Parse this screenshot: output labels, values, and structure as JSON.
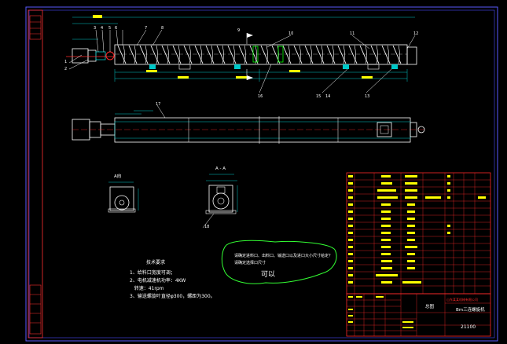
{
  "drawing": {
    "callouts": [
      "1",
      "2",
      "3",
      "4",
      "5",
      "6",
      "7",
      "8",
      "9",
      "10",
      "11",
      "12",
      "13",
      "14",
      "15",
      "16",
      "17",
      "18"
    ],
    "section_label": "A - A",
    "view_label": "A向",
    "section_marks": [
      "A",
      "A"
    ],
    "tech_requirements": {
      "title": "技术要求",
      "items": [
        "1、给料口宽度可调；",
        "2、电机减速机功率：4KW",
        "   转速：41rpm",
        "3、输送螺旋叶直径φ300，螺距为300。"
      ]
    },
    "annotation": {
      "lines": [
        "请确定进料口、出料口、输送口以及进口大小尺寸给定？",
        "请确定选择口尺寸"
      ],
      "reply": "可以"
    },
    "title_block": {
      "drawing_name": "Bm三连螺旋机",
      "drawing_no": "21100",
      "material": "总图",
      "company": "山东某某机械有限公司"
    }
  },
  "colors": {
    "background": "#000000",
    "frame": "#4b4bff",
    "outline": "#ffffff",
    "yellow": "#ffff00",
    "red": "#ff2a2a",
    "cyan": "#00c8c8",
    "green": "#33ff33"
  }
}
